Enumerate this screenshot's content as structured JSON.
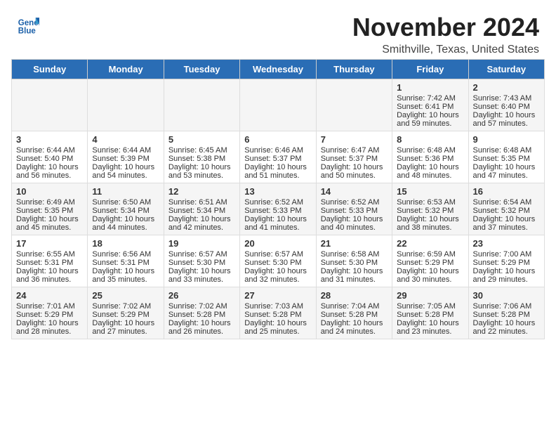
{
  "logo": {
    "name": "GeneralBlue",
    "line1": "General",
    "line2": "Blue"
  },
  "header": {
    "title": "November 2024",
    "subtitle": "Smithville, Texas, United States"
  },
  "weekdays": [
    "Sunday",
    "Monday",
    "Tuesday",
    "Wednesday",
    "Thursday",
    "Friday",
    "Saturday"
  ],
  "weeks": [
    [
      {
        "day": "",
        "sunrise": "",
        "sunset": "",
        "daylight": ""
      },
      {
        "day": "",
        "sunrise": "",
        "sunset": "",
        "daylight": ""
      },
      {
        "day": "",
        "sunrise": "",
        "sunset": "",
        "daylight": ""
      },
      {
        "day": "",
        "sunrise": "",
        "sunset": "",
        "daylight": ""
      },
      {
        "day": "",
        "sunrise": "",
        "sunset": "",
        "daylight": ""
      },
      {
        "day": "1",
        "sunrise": "Sunrise: 7:42 AM",
        "sunset": "Sunset: 6:41 PM",
        "daylight": "Daylight: 10 hours and 59 minutes."
      },
      {
        "day": "2",
        "sunrise": "Sunrise: 7:43 AM",
        "sunset": "Sunset: 6:40 PM",
        "daylight": "Daylight: 10 hours and 57 minutes."
      }
    ],
    [
      {
        "day": "3",
        "sunrise": "Sunrise: 6:44 AM",
        "sunset": "Sunset: 5:40 PM",
        "daylight": "Daylight: 10 hours and 56 minutes."
      },
      {
        "day": "4",
        "sunrise": "Sunrise: 6:44 AM",
        "sunset": "Sunset: 5:39 PM",
        "daylight": "Daylight: 10 hours and 54 minutes."
      },
      {
        "day": "5",
        "sunrise": "Sunrise: 6:45 AM",
        "sunset": "Sunset: 5:38 PM",
        "daylight": "Daylight: 10 hours and 53 minutes."
      },
      {
        "day": "6",
        "sunrise": "Sunrise: 6:46 AM",
        "sunset": "Sunset: 5:37 PM",
        "daylight": "Daylight: 10 hours and 51 minutes."
      },
      {
        "day": "7",
        "sunrise": "Sunrise: 6:47 AM",
        "sunset": "Sunset: 5:37 PM",
        "daylight": "Daylight: 10 hours and 50 minutes."
      },
      {
        "day": "8",
        "sunrise": "Sunrise: 6:48 AM",
        "sunset": "Sunset: 5:36 PM",
        "daylight": "Daylight: 10 hours and 48 minutes."
      },
      {
        "day": "9",
        "sunrise": "Sunrise: 6:48 AM",
        "sunset": "Sunset: 5:35 PM",
        "daylight": "Daylight: 10 hours and 47 minutes."
      }
    ],
    [
      {
        "day": "10",
        "sunrise": "Sunrise: 6:49 AM",
        "sunset": "Sunset: 5:35 PM",
        "daylight": "Daylight: 10 hours and 45 minutes."
      },
      {
        "day": "11",
        "sunrise": "Sunrise: 6:50 AM",
        "sunset": "Sunset: 5:34 PM",
        "daylight": "Daylight: 10 hours and 44 minutes."
      },
      {
        "day": "12",
        "sunrise": "Sunrise: 6:51 AM",
        "sunset": "Sunset: 5:34 PM",
        "daylight": "Daylight: 10 hours and 42 minutes."
      },
      {
        "day": "13",
        "sunrise": "Sunrise: 6:52 AM",
        "sunset": "Sunset: 5:33 PM",
        "daylight": "Daylight: 10 hours and 41 minutes."
      },
      {
        "day": "14",
        "sunrise": "Sunrise: 6:52 AM",
        "sunset": "Sunset: 5:33 PM",
        "daylight": "Daylight: 10 hours and 40 minutes."
      },
      {
        "day": "15",
        "sunrise": "Sunrise: 6:53 AM",
        "sunset": "Sunset: 5:32 PM",
        "daylight": "Daylight: 10 hours and 38 minutes."
      },
      {
        "day": "16",
        "sunrise": "Sunrise: 6:54 AM",
        "sunset": "Sunset: 5:32 PM",
        "daylight": "Daylight: 10 hours and 37 minutes."
      }
    ],
    [
      {
        "day": "17",
        "sunrise": "Sunrise: 6:55 AM",
        "sunset": "Sunset: 5:31 PM",
        "daylight": "Daylight: 10 hours and 36 minutes."
      },
      {
        "day": "18",
        "sunrise": "Sunrise: 6:56 AM",
        "sunset": "Sunset: 5:31 PM",
        "daylight": "Daylight: 10 hours and 35 minutes."
      },
      {
        "day": "19",
        "sunrise": "Sunrise: 6:57 AM",
        "sunset": "Sunset: 5:30 PM",
        "daylight": "Daylight: 10 hours and 33 minutes."
      },
      {
        "day": "20",
        "sunrise": "Sunrise: 6:57 AM",
        "sunset": "Sunset: 5:30 PM",
        "daylight": "Daylight: 10 hours and 32 minutes."
      },
      {
        "day": "21",
        "sunrise": "Sunrise: 6:58 AM",
        "sunset": "Sunset: 5:30 PM",
        "daylight": "Daylight: 10 hours and 31 minutes."
      },
      {
        "day": "22",
        "sunrise": "Sunrise: 6:59 AM",
        "sunset": "Sunset: 5:29 PM",
        "daylight": "Daylight: 10 hours and 30 minutes."
      },
      {
        "day": "23",
        "sunrise": "Sunrise: 7:00 AM",
        "sunset": "Sunset: 5:29 PM",
        "daylight": "Daylight: 10 hours and 29 minutes."
      }
    ],
    [
      {
        "day": "24",
        "sunrise": "Sunrise: 7:01 AM",
        "sunset": "Sunset: 5:29 PM",
        "daylight": "Daylight: 10 hours and 28 minutes."
      },
      {
        "day": "25",
        "sunrise": "Sunrise: 7:02 AM",
        "sunset": "Sunset: 5:29 PM",
        "daylight": "Daylight: 10 hours and 27 minutes."
      },
      {
        "day": "26",
        "sunrise": "Sunrise: 7:02 AM",
        "sunset": "Sunset: 5:28 PM",
        "daylight": "Daylight: 10 hours and 26 minutes."
      },
      {
        "day": "27",
        "sunrise": "Sunrise: 7:03 AM",
        "sunset": "Sunset: 5:28 PM",
        "daylight": "Daylight: 10 hours and 25 minutes."
      },
      {
        "day": "28",
        "sunrise": "Sunrise: 7:04 AM",
        "sunset": "Sunset: 5:28 PM",
        "daylight": "Daylight: 10 hours and 24 minutes."
      },
      {
        "day": "29",
        "sunrise": "Sunrise: 7:05 AM",
        "sunset": "Sunset: 5:28 PM",
        "daylight": "Daylight: 10 hours and 23 minutes."
      },
      {
        "day": "30",
        "sunrise": "Sunrise: 7:06 AM",
        "sunset": "Sunset: 5:28 PM",
        "daylight": "Daylight: 10 hours and 22 minutes."
      }
    ]
  ]
}
